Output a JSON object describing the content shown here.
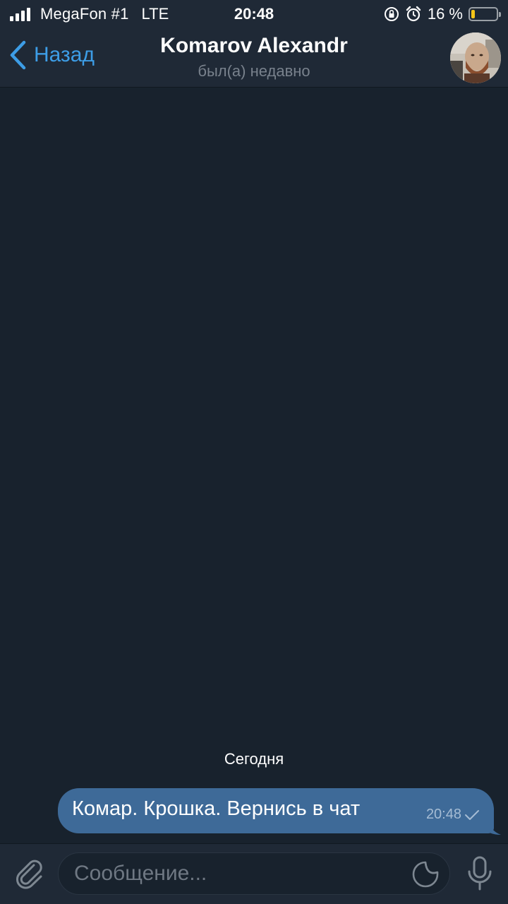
{
  "status_bar": {
    "carrier": "MegaFon #1",
    "network": "LTE",
    "time": "20:48",
    "battery_percent": "16 %",
    "battery_level": 0.16,
    "battery_color": "#f5c518"
  },
  "header": {
    "back_label": "Назад",
    "title": "Komarov Alexandr",
    "subtitle": "был(а) недавно"
  },
  "chat": {
    "date_separator": "Сегодня",
    "messages": [
      {
        "text": "Комар. Крошка. Вернись в чат",
        "time": "20:48",
        "status": "sent"
      }
    ]
  },
  "input": {
    "placeholder": "Сообщение..."
  },
  "icons": [
    "signal-icon",
    "orientation-lock-icon",
    "alarm-icon",
    "battery-icon",
    "back-chevron-icon",
    "attach-icon",
    "sticker-icon",
    "microphone-icon",
    "check-icon"
  ],
  "colors": {
    "background": "#18222d",
    "bar": "#1f2936",
    "accent": "#3d9de6",
    "outgoing_bubble": "#3e6a98"
  }
}
